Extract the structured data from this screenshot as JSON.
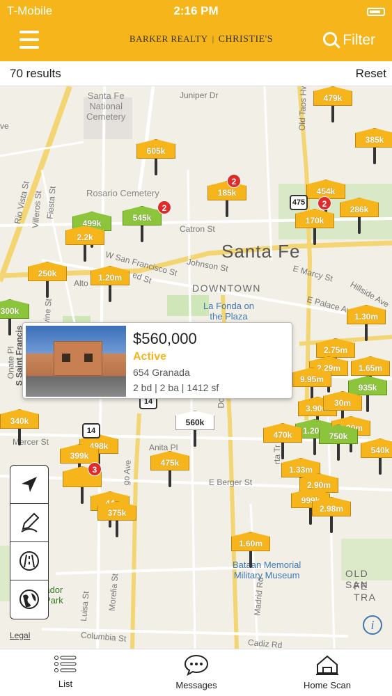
{
  "status_bar": {
    "carrier": "T-Mobile",
    "time": "2:16 PM"
  },
  "header": {
    "logo_left": "BARKER REALTY",
    "logo_right": "CHRISTIE'S",
    "filter_label": "Filter",
    "accent_color": "#f7b51c"
  },
  "results": {
    "count_label": "70 results",
    "reset_label": "Reset"
  },
  "map": {
    "city": "Santa Fe",
    "district": "DOWNTOWN",
    "district2": "OLD SAN",
    "district2b": "FE TRA",
    "pois": {
      "cemetery_national": "Santa Fe\nNational\nCemetery",
      "rosario": "Rosario Cemetery",
      "la_fonda": "La Fonda on\nthe Plaza",
      "bataan": "Bataan Memorial\nMilitary Museum",
      "park": "ador\nPark"
    },
    "streets": {
      "juniper": "Juniper Dr",
      "old_taos": "Old Taos Hwy",
      "rio_vista": "Rio Vista St",
      "villeros": "Villeros St",
      "fiesta": "Fiesta St",
      "catron": "Catron St",
      "w_san_francisco": "W San Francisco St",
      "johnson": "Johnson St",
      "e_marcy": "E Marcy St",
      "e_palace": "E Palace Ave",
      "hillside": "Hillside Ave",
      "alto": "Alto",
      "ed_st": "ed St",
      "irvine": "Irvine St",
      "saint_francis": "S Saint Francis",
      "onate": "Onate Pl",
      "mercer": "Mercer St",
      "anita": "Anita Pl",
      "e_berger": "E Berger St",
      "morelia": "Morelia St",
      "luisa": "Luisa St",
      "madrid": "Madrid Rd",
      "columbia": "Columbia St",
      "cadiz": "Cadiz Rd",
      "rta_tr": "rta Tr",
      "go_ave": "go Ave",
      "do": "Do",
      "ve": "ve"
    },
    "route_shields": [
      "14",
      "14",
      "475"
    ],
    "markers": [
      {
        "label": "479k",
        "color": "yellow"
      },
      {
        "label": "385k",
        "color": "yellow"
      },
      {
        "label": "605k",
        "color": "yellow"
      },
      {
        "label": "185k",
        "color": "yellow"
      },
      {
        "label": "454k",
        "color": "yellow"
      },
      {
        "label": "286k",
        "color": "yellow"
      },
      {
        "label": "170k",
        "color": "yellow"
      },
      {
        "label": "545k",
        "color": "green"
      },
      {
        "label": "499k",
        "color": "green"
      },
      {
        "label": "2.2k",
        "color": "yellow"
      },
      {
        "label": "250k",
        "color": "yellow"
      },
      {
        "label": "1.20m",
        "color": "yellow"
      },
      {
        "label": "300k",
        "color": "green"
      },
      {
        "label": "1.30m",
        "color": "yellow"
      },
      {
        "label": "2.75m",
        "color": "yellow"
      },
      {
        "label": "2.29m",
        "color": "yellow"
      },
      {
        "label": "1.65m",
        "color": "yellow"
      },
      {
        "label": "9.95m",
        "color": "yellow"
      },
      {
        "label": "935k",
        "color": "green"
      },
      {
        "label": "3.90m",
        "color": "yellow"
      },
      {
        "label": "30m",
        "color": "yellow"
      },
      {
        "label": "1.20m",
        "color": "green"
      },
      {
        "label": "1.30m",
        "color": "yellow"
      },
      {
        "label": "470k",
        "color": "yellow"
      },
      {
        "label": "750k",
        "color": "green"
      },
      {
        "label": "540k",
        "color": "yellow"
      },
      {
        "label": "340k",
        "color": "yellow"
      },
      {
        "label": "560k",
        "color": "white"
      },
      {
        "label": "498k",
        "color": "yellow"
      },
      {
        "label": "399k",
        "color": "yellow"
      },
      {
        "label": "475k",
        "color": "yellow"
      },
      {
        "label": "44",
        "color": "yellow"
      },
      {
        "label": "375k",
        "color": "yellow"
      },
      {
        "label": "1.33m",
        "color": "yellow"
      },
      {
        "label": "2.90m",
        "color": "yellow"
      },
      {
        "label": "999k",
        "color": "yellow"
      },
      {
        "label": "2.98m",
        "color": "yellow"
      },
      {
        "label": "1.60m",
        "color": "yellow"
      },
      {
        "label": "",
        "color": "yellow"
      }
    ],
    "badges": [
      "2",
      "2",
      "3",
      "2"
    ],
    "legal_label": "Legal",
    "info_label": "i"
  },
  "card": {
    "price": "$560,000",
    "status": "Active",
    "address": "654 Granada",
    "specs": "2 bd | 2 ba | 1412 sf"
  },
  "tools": [
    "location-arrow-icon",
    "draw-pencil-icon",
    "road-icon",
    "globe-icon"
  ],
  "tabs": [
    {
      "label": "List",
      "icon": "list-icon"
    },
    {
      "label": "Messages",
      "icon": "messages-icon"
    },
    {
      "label": "Home Scan",
      "icon": "home-scan-icon"
    }
  ]
}
